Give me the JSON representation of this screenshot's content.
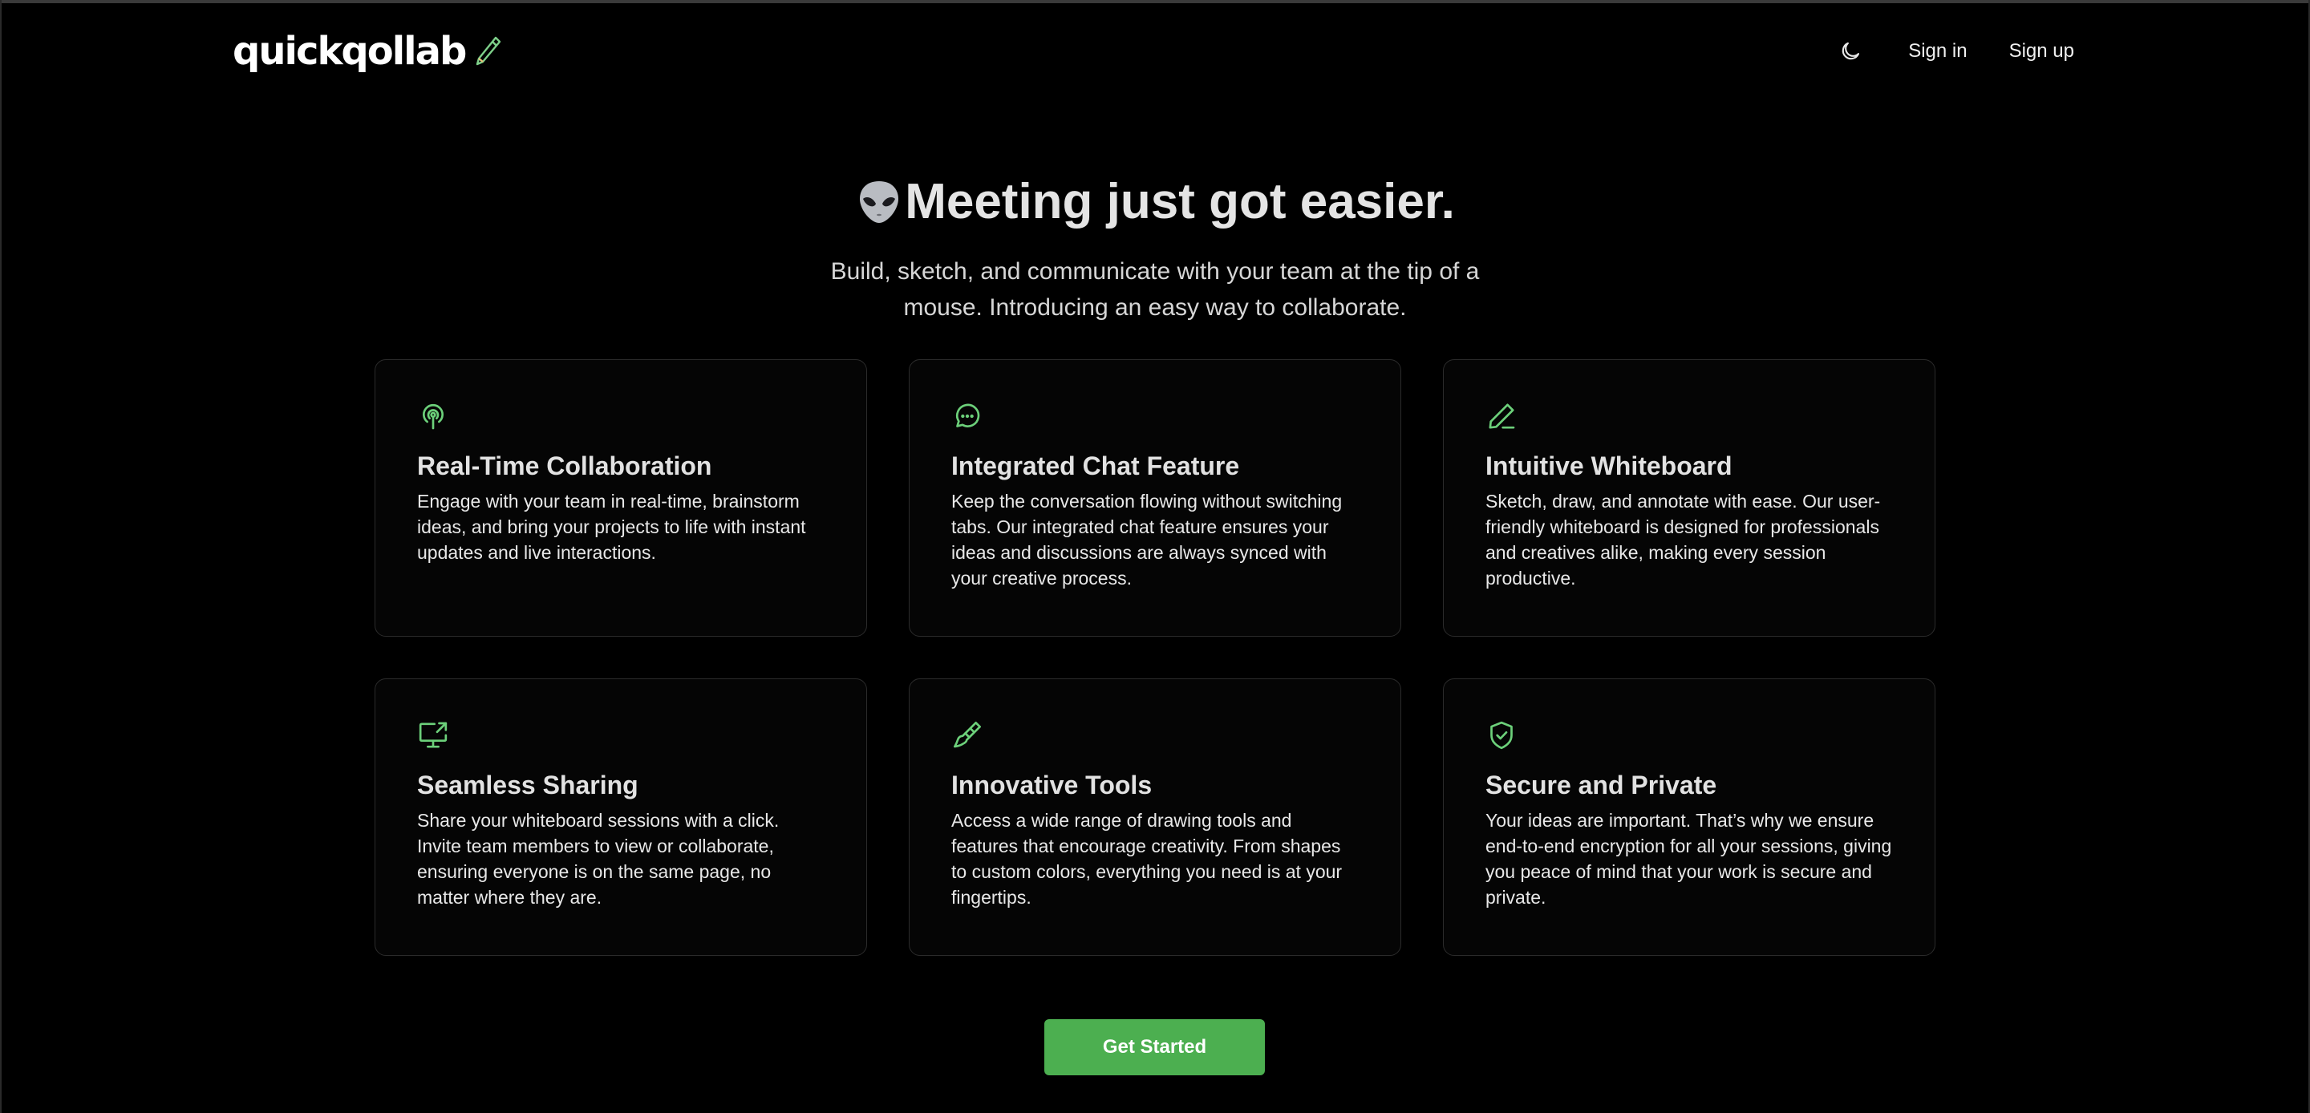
{
  "header": {
    "logo_text": "quickqollab",
    "nav": {
      "sign_in": "Sign in",
      "sign_up": "Sign up"
    }
  },
  "hero": {
    "title": "Meeting just got easier.",
    "subtitle": "Build, sketch, and communicate with your team at the tip of a mouse. Introducing an easy way to collaborate."
  },
  "features": [
    {
      "icon": "broadcast-icon",
      "title": "Real-Time Collaboration",
      "description": "Engage with your team in real-time, brainstorm ideas, and bring your projects to life with instant updates and live interactions."
    },
    {
      "icon": "chat-bubble-icon",
      "title": "Integrated Chat Feature",
      "description": "Keep the conversation flowing without switching tabs. Our integrated chat feature ensures your ideas and discussions are always synced with your creative process."
    },
    {
      "icon": "pen-icon",
      "title": "Intuitive Whiteboard",
      "description": "Sketch, draw, and annotate with ease. Our user-friendly whiteboard is designed for professionals and creatives alike, making every session productive."
    },
    {
      "icon": "screen-share-icon",
      "title": "Seamless Sharing",
      "description": "Share your whiteboard sessions with a click. Invite team members to view or collaborate, ensuring everyone is on the same page, no matter where they are."
    },
    {
      "icon": "paintbrush-icon",
      "title": "Innovative Tools",
      "description": "Access a wide range of drawing tools and features that encourage creativity. From shapes to custom colors, everything you need is at your fingertips."
    },
    {
      "icon": "shield-check-icon",
      "title": "Secure and Private",
      "description": "Your ideas are important. That’s why we ensure end-to-end encryption for all your sessions, giving you peace of mind that your work is secure and private."
    }
  ],
  "cta": {
    "label": "Get Started"
  },
  "colors": {
    "background": "#000000",
    "accent": "#4caf50",
    "icon": "#6cd07a",
    "card_border": "#2b2b2b"
  }
}
